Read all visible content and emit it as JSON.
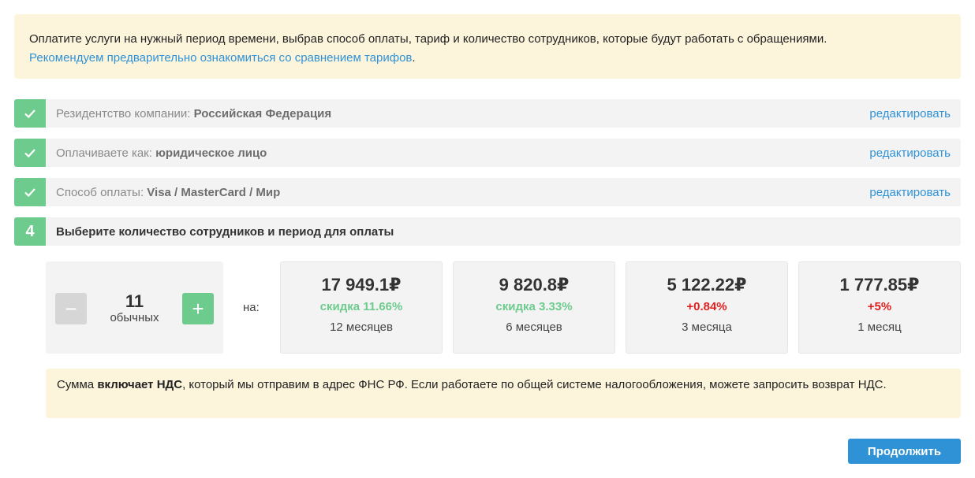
{
  "info": {
    "text": "Оплатите услуги на нужный период времени, выбрав способ оплаты, тариф и количество сотрудников, которые будут работать с обращениями.",
    "link": "Рекомендуем предварительно ознакомиться со сравнением тарифов",
    "link_suffix": "."
  },
  "steps": [
    {
      "label": "Резидентство компании: ",
      "value": "Российская Федерация",
      "edit": "редактировать"
    },
    {
      "label": "Оплачиваете как: ",
      "value": "юридическое лицо",
      "edit": "редактировать"
    },
    {
      "label": "Способ оплаты: ",
      "value": "Visa / MasterCard / Мир",
      "edit": "редактировать"
    },
    {
      "number": "4",
      "label": "Выберите количество сотрудников и период для оплаты"
    }
  ],
  "counter": {
    "minus": "−",
    "plus": "+",
    "value": "11",
    "unit": "обычных"
  },
  "na_label": "на:",
  "prices": [
    {
      "amount": "17 949.1₽",
      "delta": "скидка 11.66%",
      "period": "12 месяцев"
    },
    {
      "amount": "9 820.8₽",
      "delta": "скидка 3.33%",
      "period": "6 месяцев"
    },
    {
      "amount": "5 122.22₽",
      "delta": "+0.84%",
      "period": "3 месяца"
    },
    {
      "amount": "1 777.85₽",
      "delta": "+5%",
      "period": "1 месяц"
    }
  ],
  "vat": {
    "prefix": "Сумма ",
    "bold": "включает НДС",
    "suffix": ", который мы отправим в адрес ФНС РФ. Если работаете по общей системе налогообложения, можете запросить возврат НДС."
  },
  "continue_label": "Продолжить",
  "colors": {
    "accent_green": "#6dcb8e",
    "link_blue": "#2f92d6",
    "discount_red": "#e02020",
    "info_bg": "#fdf4dc"
  },
  "icons": {
    "step_done": "checkmark-icon"
  }
}
